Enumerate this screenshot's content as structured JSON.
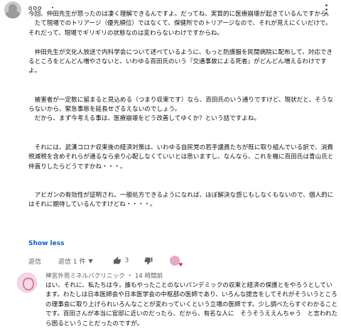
{
  "top_comment": {
    "author": "ooo　・",
    "timestamp": "",
    "text": "今回、仲田先生が怒ったのは凄く理解できるんですよ。だってね、実質的に医療崩壊が起きているんですから。\n　たて現場でのトリアージ（優先順位）ではなくて、保健所でのトリアージなので、それが見えにくいだけで。それだって、現場でギリギリの状態なのは変わらないわけですからね。\n\n　仲田先生が文化人放送で内科学会について述べているように、もっと防護服を民間病院に配布して、対応できるところをどんどん増やさないと、いわゆる百田氏のいう『交通事故による死者』がどんどん増えるわけですよ。\n\n\n　被害者が一定数に留まると見込める（つまり収束です）なら、百田氏のいう通りですけど、現状だと、そうならないから、緊急事態を延長せざるえないのでしょう。\n　だから、まず今考える事は、医療崩壊をどう改善してゆくか？という話ですよね。\n\n\n　それには、武漢コロナ収束後の経済対策は、いわゆる自民党の若手議員たちが既に取り組んでいる訳で、消費税減税を含めそれらが通るなら余り心配しなくていいとは思いますし、なんなら、これを機に百田氏は青山氏と仲直りしたらどうですかね・・・。\n\n\n　アビガンの有効性が証明され、一般処方できるようになれば、ほぼ解決な感じもしなくもないので、個人的にはそれに期待しているんですけどね・・・・。",
    "show_less_label": "Show less",
    "reply_label": "返信",
    "replies_count_label": "返信 1 件",
    "likes": "3"
  },
  "reply": {
    "author": "神宮外苑ミネルバクリニック",
    "separator": "・",
    "timestamp": "14 時間前",
    "text": "はい、それに、私たちは今，誰もやったことのないパンデミックの収束と経済の保護とをやろうとしています。わたしは日本医師会や日本医学会の中枢部の医師であり、いろんな提言をしてそれがそういうところの理事会に取り上げられいろんなことが変わっていくという立場の医師です。少し調べたらすぐわかることです。百田さんが本当に官邸に近いのだったら、だから、有名な人に　そうそうええんちゃう　と言われたら困るということだったのですが。"
  }
}
